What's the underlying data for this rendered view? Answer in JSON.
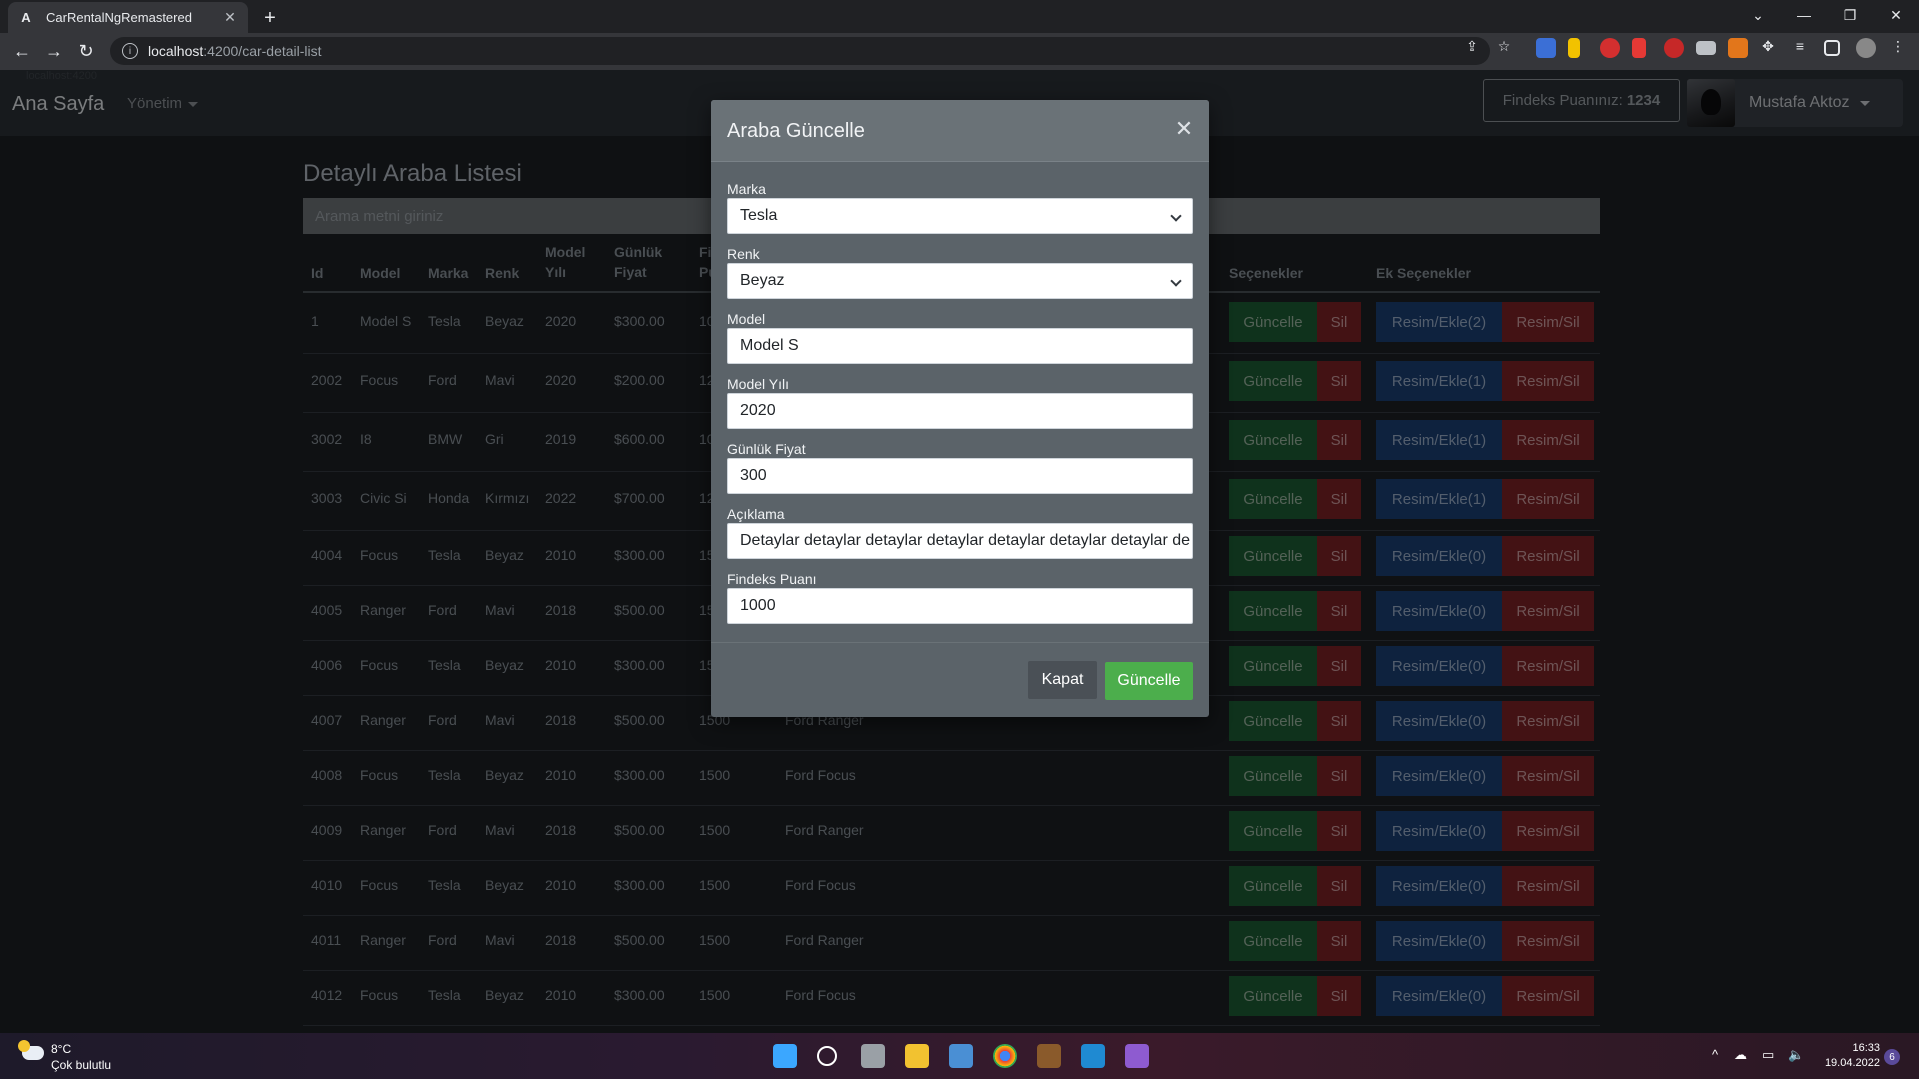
{
  "browser": {
    "tab_title": "CarRentalNgRemastered",
    "tab_favicon": "A",
    "url_host": "localhost",
    "url_path": ":4200/car-detail-list",
    "status_hint": "localhost:4200"
  },
  "navbar": {
    "brand": "Ana Sayfa",
    "menu_yonetim": "Yönetim",
    "findeks_label": "Findeks Puanınız:",
    "findeks_value": "1234",
    "user_name": "Mustafa Aktoz"
  },
  "page": {
    "title": "Detaylı Araba Listesi",
    "search_placeholder": "Arama metni giriniz"
  },
  "table": {
    "headers": {
      "id": "Id",
      "model": "Model",
      "marka": "Marka",
      "renk": "Renk",
      "model_yili_1": "Model",
      "model_yili_2": "Yılı",
      "gunluk_1": "Günlük",
      "gunluk_2": "Fiyat",
      "findeks_1": "Fi",
      "findeks_2": "Pu",
      "secenekler": "Seçenekler",
      "ek_secenekler": "Ek Seçenekler"
    },
    "rows": [
      {
        "id": "1",
        "model": "Model S",
        "marka": "Tesla",
        "renk": "Beyaz",
        "yil": "2020",
        "fiyat": "$300.00",
        "findeks": "10",
        "aciklama": "",
        "resim": "Resim/Ekle(2)"
      },
      {
        "id": "2002",
        "model": "Focus",
        "marka": "Ford",
        "renk": "Mavi",
        "yil": "2020",
        "fiyat": "$200.00",
        "findeks": "12",
        "aciklama": "",
        "resim": "Resim/Ekle(1)"
      },
      {
        "id": "3002",
        "model": "I8",
        "marka": "BMW",
        "renk": "Gri",
        "yil": "2019",
        "fiyat": "$600.00",
        "findeks": "10",
        "aciklama": "",
        "resim": "Resim/Ekle(1)"
      },
      {
        "id": "3003",
        "model": "Civic Si",
        "marka": "Honda",
        "renk": "Kırmızı",
        "yil": "2022",
        "fiyat": "$700.00",
        "findeks": "12",
        "aciklama": "",
        "resim": "Resim/Ekle(1)"
      },
      {
        "id": "4004",
        "model": "Focus",
        "marka": "Tesla",
        "renk": "Beyaz",
        "yil": "2010",
        "fiyat": "$300.00",
        "findeks": "15",
        "aciklama": "",
        "resim": "Resim/Ekle(0)"
      },
      {
        "id": "4005",
        "model": "Ranger",
        "marka": "Ford",
        "renk": "Mavi",
        "yil": "2018",
        "fiyat": "$500.00",
        "findeks": "15",
        "aciklama": "",
        "resim": "Resim/Ekle(0)"
      },
      {
        "id": "4006",
        "model": "Focus",
        "marka": "Tesla",
        "renk": "Beyaz",
        "yil": "2010",
        "fiyat": "$300.00",
        "findeks": "15",
        "aciklama": "",
        "resim": "Resim/Ekle(0)"
      },
      {
        "id": "4007",
        "model": "Ranger",
        "marka": "Ford",
        "renk": "Mavi",
        "yil": "2018",
        "fiyat": "$500.00",
        "findeks": "1500",
        "aciklama": "Ford Ranger",
        "resim": "Resim/Ekle(0)"
      },
      {
        "id": "4008",
        "model": "Focus",
        "marka": "Tesla",
        "renk": "Beyaz",
        "yil": "2010",
        "fiyat": "$300.00",
        "findeks": "1500",
        "aciklama": "Ford Focus",
        "resim": "Resim/Ekle(0)"
      },
      {
        "id": "4009",
        "model": "Ranger",
        "marka": "Ford",
        "renk": "Mavi",
        "yil": "2018",
        "fiyat": "$500.00",
        "findeks": "1500",
        "aciklama": "Ford Ranger",
        "resim": "Resim/Ekle(0)"
      },
      {
        "id": "4010",
        "model": "Focus",
        "marka": "Tesla",
        "renk": "Beyaz",
        "yil": "2010",
        "fiyat": "$300.00",
        "findeks": "1500",
        "aciklama": "Ford Focus",
        "resim": "Resim/Ekle(0)"
      },
      {
        "id": "4011",
        "model": "Ranger",
        "marka": "Ford",
        "renk": "Mavi",
        "yil": "2018",
        "fiyat": "$500.00",
        "findeks": "1500",
        "aciklama": "Ford Ranger",
        "resim": "Resim/Ekle(0)"
      },
      {
        "id": "4012",
        "model": "Focus",
        "marka": "Tesla",
        "renk": "Beyaz",
        "yil": "2010",
        "fiyat": "$300.00",
        "findeks": "1500",
        "aciklama": "Ford Focus",
        "resim": "Resim/Ekle(0)"
      }
    ],
    "btn_guncelle": "Güncelle",
    "btn_sil": "Sil",
    "btn_resim_sil": "Resim/Sil"
  },
  "modal": {
    "title": "Araba Güncelle",
    "fields": {
      "marka_label": "Marka",
      "marka_value": "Tesla",
      "renk_label": "Renk",
      "renk_value": "Beyaz",
      "model_label": "Model",
      "model_value": "Model S",
      "yil_label": "Model Yılı",
      "yil_value": "2020",
      "fiyat_label": "Günlük Fiyat",
      "fiyat_value": "300",
      "aciklama_label": "Açıklama",
      "aciklama_value": "Detaylar detaylar detaylar detaylar detaylar detaylar detaylar de",
      "findeks_label": "Findeks Puanı",
      "findeks_value": "1000"
    },
    "btn_close": "Kapat",
    "btn_save": "Güncelle"
  },
  "taskbar": {
    "temp": "8°C",
    "weather": "Çok bulutlu",
    "time": "16:33",
    "date": "19.04.2022",
    "notifications": "6"
  }
}
